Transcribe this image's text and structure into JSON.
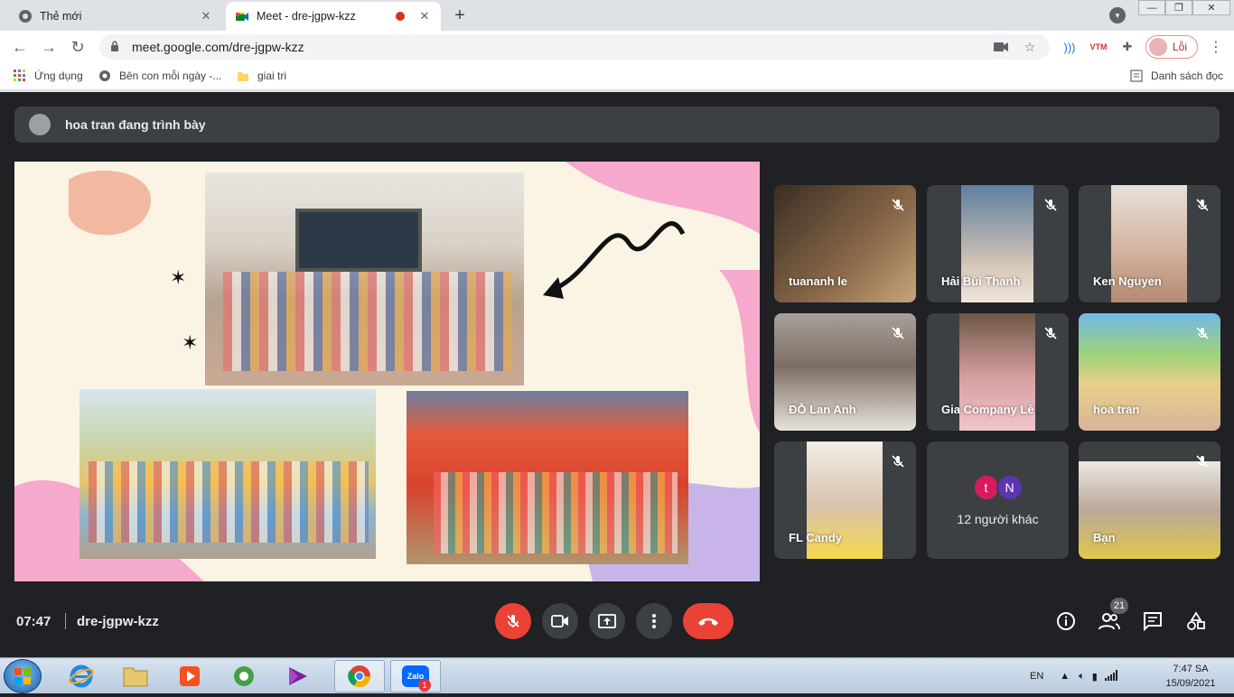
{
  "browser": {
    "tabs": [
      {
        "title": "Thẻ mới",
        "active": false
      },
      {
        "title": "Meet - dre-jgpw-kzz",
        "active": true
      }
    ],
    "url": "meet.google.com/dre-jgpw-kzz",
    "profile_label": "Lỗi",
    "bookmarks": [
      {
        "label": "Ứng dụng",
        "icon": "apps-grid-icon"
      },
      {
        "label": "Bên con mỗi ngày -...",
        "icon": "globe-icon"
      },
      {
        "label": "giai tri",
        "icon": "folder-icon"
      }
    ],
    "reading_list": "Danh sách đọc",
    "ext_vtm": "VTM"
  },
  "meet": {
    "presenting_text": "hoa tran đang trình bày",
    "participants": [
      {
        "name": "tuananh le",
        "bg": "#5a4a3a"
      },
      {
        "name": "Hải Bùi Thanh",
        "bg": "#7b8fa3"
      },
      {
        "name": "Ken Nguyen",
        "bg": "#d9cfc4"
      },
      {
        "name": "ĐỖ Lan Anh",
        "bg": "#8f8a86"
      },
      {
        "name": "Gia Company Lê",
        "bg": "#b58f7c"
      },
      {
        "name": "hoa tran",
        "bg": "#6fb86b"
      },
      {
        "name": "FL Candy",
        "bg": "#e8e2d9"
      },
      {
        "name": "Bạn",
        "bg": "#c8c0b8"
      }
    ],
    "others": {
      "initials": [
        "t",
        "N"
      ],
      "colors": [
        "#d81b60",
        "#5e35b1"
      ],
      "label": "12 người khác"
    },
    "time": "07:47",
    "meeting_code": "dre-jgpw-kzz",
    "participant_count": "21"
  },
  "taskbar": {
    "lang": "EN",
    "clock_time": "7:47 SA",
    "clock_date": "15/09/2021",
    "zalo_label": "Zalo",
    "zalo_badge": "1"
  }
}
